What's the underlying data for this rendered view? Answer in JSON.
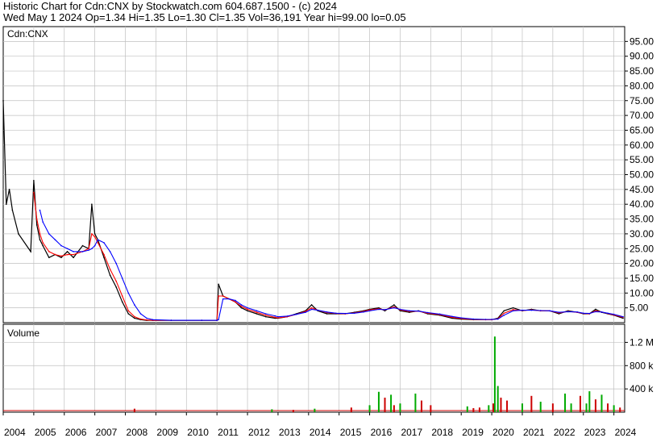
{
  "header": {
    "line1": "Historic Chart for Cdn:CNX by Stockwatch.com 604.687.1500 - (c) 2024",
    "line2": "Wed May  1 2024   Op=1.34  Hi=1.35  Lo=1.30  Cl=1.35  Vol=36,191  Year hi=99.00  lo=0.05"
  },
  "colors": {
    "background": "#ffffff",
    "grid": "#c0c0c0",
    "axis": "#000000",
    "price_bar": "#000000",
    "moving_avg_short": "#ff0000",
    "moving_avg_long": "#0000ff",
    "volume_up": "#00aa00",
    "volume_down": "#cc0000"
  },
  "chart_data": [
    {
      "type": "line",
      "panel": "price",
      "label": "Cdn:CNX",
      "ylim": [
        0,
        100
      ],
      "yticks": [
        5,
        10,
        15,
        20,
        25,
        30,
        35,
        40,
        45,
        50,
        55,
        60,
        65,
        70,
        75,
        80,
        85,
        90,
        95
      ],
      "ytick_labels": [
        "5.00",
        "10.00",
        "15.00",
        "20.00",
        "25.00",
        "30.00",
        "35.00",
        "40.00",
        "45.00",
        "50.00",
        "55.00",
        "60.00",
        "65.00",
        "70.00",
        "75.00",
        "80.00",
        "85.00",
        "90.00",
        "95.00"
      ],
      "grid": true,
      "x": [
        2004.0,
        2004.1,
        2004.2,
        2004.3,
        2004.5,
        2004.9,
        2005.0,
        2005.1,
        2005.2,
        2005.3,
        2005.5,
        2005.7,
        2005.9,
        2006.1,
        2006.3,
        2006.6,
        2006.8,
        2006.9,
        2007.0,
        2007.1,
        2007.3,
        2007.5,
        2007.7,
        2007.9,
        2008.1,
        2008.3,
        2008.5,
        2008.7,
        2008.9,
        2009.5,
        2010.5,
        2011.0,
        2011.05,
        2011.2,
        2011.4,
        2011.6,
        2011.8,
        2012.0,
        2012.3,
        2012.6,
        2012.9,
        2013.0,
        2013.3,
        2013.6,
        2013.9,
        2014.1,
        2014.3,
        2014.6,
        2014.9,
        2015.2,
        2015.5,
        2015.8,
        2016.0,
        2016.3,
        2016.5,
        2016.8,
        2017.0,
        2017.3,
        2017.6,
        2017.9,
        2018.3,
        2018.7,
        2019.0,
        2019.4,
        2019.8,
        2020.0,
        2020.2,
        2020.4,
        2020.7,
        2021.0,
        2021.3,
        2021.6,
        2021.9,
        2022.2,
        2022.5,
        2022.8,
        2023.0,
        2023.2,
        2023.4,
        2023.6,
        2023.8,
        2024.0,
        2024.3
      ],
      "series": [
        {
          "values": [
            75,
            40,
            45,
            38,
            30,
            24,
            48,
            33,
            28,
            26,
            22,
            23,
            22,
            24,
            22,
            26,
            25,
            40,
            30,
            28,
            22,
            16,
            12,
            7,
            3,
            1.5,
            1,
            0.8,
            0.8,
            0.8,
            0.8,
            0.8,
            13,
            9,
            8,
            7,
            5,
            4,
            3,
            2,
            1.5,
            1.5,
            2,
            3,
            4,
            6,
            4,
            3,
            3,
            3,
            3.5,
            4,
            4.5,
            5,
            4,
            6,
            4,
            3.5,
            4,
            3,
            2.5,
            1.5,
            1.2,
            1,
            1,
            1,
            1.5,
            4,
            5,
            4,
            4.5,
            4,
            4,
            3,
            4,
            3.5,
            3,
            3,
            4.5,
            3.5,
            3,
            2.5,
            1.5
          ]
        },
        {
          "values": [
            null,
            null,
            null,
            null,
            null,
            null,
            44,
            35,
            30,
            27,
            24,
            23,
            22.5,
            23,
            23,
            24,
            25,
            30,
            29,
            27,
            23,
            18,
            14,
            9,
            4,
            2,
            1.2,
            0.9,
            0.8,
            0.8,
            0.8,
            0.8,
            9,
            9,
            8,
            7,
            5.5,
            4.5,
            3.5,
            2.5,
            1.8,
            1.6,
            2,
            2.8,
            3.8,
            5,
            4.2,
            3.4,
            3.1,
            3,
            3.3,
            3.8,
            4.3,
            4.7,
            4.3,
            5.3,
            4.3,
            3.8,
            3.9,
            3.2,
            2.7,
            1.8,
            1.4,
            1.1,
            1,
            1,
            1.3,
            3.2,
            4.4,
            4.1,
            4.3,
            4,
            4,
            3.3,
            3.8,
            3.5,
            3.1,
            3,
            4,
            3.6,
            3.1,
            2.6,
            1.8
          ]
        },
        {
          "values": [
            null,
            null,
            null,
            null,
            null,
            null,
            null,
            null,
            38,
            34,
            30,
            28,
            26,
            25,
            24,
            24,
            24.5,
            25,
            26,
            28,
            27,
            24,
            20,
            15,
            10,
            6,
            3,
            1.5,
            1,
            0.8,
            0.8,
            0.8,
            1,
            8,
            8,
            7.5,
            6,
            5,
            4,
            3,
            2.3,
            2,
            2.2,
            2.8,
            3.5,
            4.5,
            4.2,
            3.6,
            3.2,
            3.1,
            3.2,
            3.6,
            4,
            4.5,
            4.4,
            5,
            4.5,
            4,
            3.9,
            3.4,
            2.9,
            2.1,
            1.6,
            1.2,
            1.1,
            1.1,
            1.2,
            2.5,
            4,
            4.2,
            4.2,
            4.1,
            4,
            3.5,
            3.7,
            3.6,
            3.2,
            3.1,
            3.7,
            3.6,
            3.2,
            2.8,
            2
          ]
        }
      ]
    },
    {
      "type": "bar",
      "panel": "volume",
      "label": "Volume",
      "ylim": [
        0,
        1400000
      ],
      "yticks": [
        400000,
        800000,
        1200000
      ],
      "ytick_labels": [
        "400 k",
        "800 k",
        "1.2 M"
      ],
      "x": [
        2008.3,
        2012.8,
        2013.5,
        2014.2,
        2015.4,
        2016.0,
        2016.3,
        2016.5,
        2016.7,
        2016.8,
        2017.0,
        2017.5,
        2017.7,
        2018.0,
        2019.2,
        2019.4,
        2019.6,
        2019.9,
        2020.05,
        2020.1,
        2020.2,
        2020.3,
        2020.5,
        2021.0,
        2021.3,
        2021.6,
        2022.0,
        2022.4,
        2022.6,
        2022.9,
        2023.1,
        2023.2,
        2023.4,
        2023.6,
        2023.8,
        2024.0,
        2024.2
      ],
      "values": [
        60000,
        50000,
        40000,
        60000,
        80000,
        120000,
        350000,
        250000,
        300000,
        120000,
        150000,
        320000,
        200000,
        120000,
        100000,
        70000,
        80000,
        120000,
        150000,
        1300000,
        450000,
        250000,
        200000,
        150000,
        280000,
        180000,
        150000,
        320000,
        150000,
        280000,
        150000,
        360000,
        220000,
        300000,
        150000,
        120000,
        80000
      ],
      "up": [
        false,
        true,
        false,
        true,
        false,
        true,
        true,
        false,
        true,
        false,
        true,
        true,
        false,
        false,
        true,
        false,
        false,
        true,
        false,
        true,
        true,
        false,
        false,
        true,
        false,
        true,
        false,
        true,
        true,
        false,
        true,
        true,
        false,
        true,
        false,
        true,
        false
      ]
    }
  ],
  "x_axis": {
    "ticks": [
      2004,
      2005,
      2006,
      2007,
      2008,
      2009,
      2010,
      2011,
      2012,
      2013,
      2014,
      2015,
      2016,
      2017,
      2018,
      2019,
      2020,
      2021,
      2022,
      2023,
      2024
    ],
    "labels": [
      "2004",
      "2005",
      "2006",
      "2007",
      "2008",
      "2009",
      "2010",
      "2011",
      "2012",
      "2013",
      "2014",
      "2015",
      "2016",
      "2017",
      "2018",
      "2019",
      "2020",
      "2021",
      "2022",
      "2023",
      "2024"
    ]
  }
}
